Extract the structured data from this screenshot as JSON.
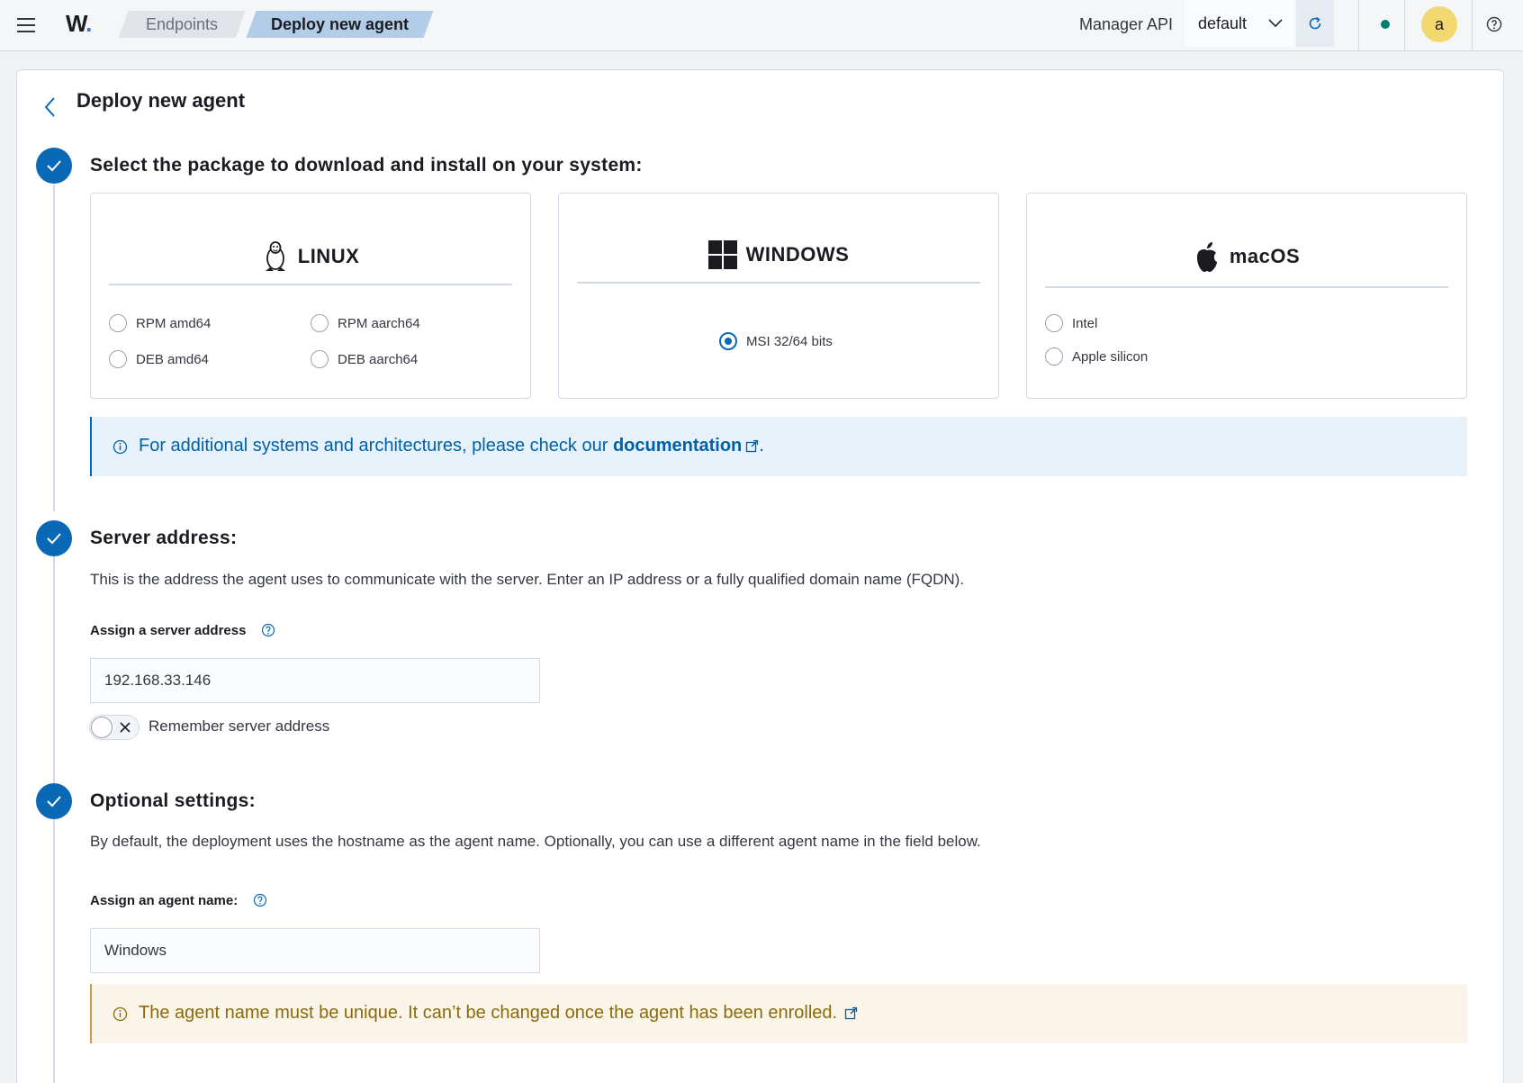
{
  "header": {
    "logo_text": "W",
    "logo_dot": ".",
    "breadcrumbs": [
      "Endpoints",
      "Deploy new agent"
    ],
    "manager_api_label": "Manager API",
    "api_selected": "default",
    "avatar_initial": "a",
    "status_color": "#017d73"
  },
  "page": {
    "title": "Deploy new agent"
  },
  "step1": {
    "title": "Select the package to download and install on your system:",
    "linux": {
      "name": "LINUX",
      "options": [
        "RPM amd64",
        "RPM aarch64",
        "DEB amd64",
        "DEB aarch64"
      ]
    },
    "windows": {
      "name": "WINDOWS",
      "options": [
        "MSI 32/64 bits"
      ],
      "selected": "MSI 32/64 bits"
    },
    "macos": {
      "name": "macOS",
      "options": [
        "Intel",
        "Apple silicon"
      ]
    },
    "info_prefix": "For additional systems and architectures, please check our",
    "info_link": "documentation",
    "info_suffix": "."
  },
  "step2": {
    "title": "Server address:",
    "description": "This is the address the agent uses to communicate with the server. Enter an IP address or a fully qualified domain name (FQDN).",
    "field_label": "Assign a server address",
    "field_value": "192.168.33.146",
    "toggle_label": "Remember server address",
    "toggle_on": false
  },
  "step3": {
    "title": "Optional settings:",
    "description": "By default, the deployment uses the hostname as the agent name. Optionally, you can use a different agent name in the field below.",
    "field_label": "Assign an agent name:",
    "field_value": "Windows",
    "warning": "The agent name must be unique. It can’t be changed once the agent has been enrolled."
  },
  "colors": {
    "accent": "#0969b7",
    "info_bg": "#e6f1fa",
    "warning_bg": "#fbf5e9",
    "warning_text": "#8a6a0a"
  }
}
